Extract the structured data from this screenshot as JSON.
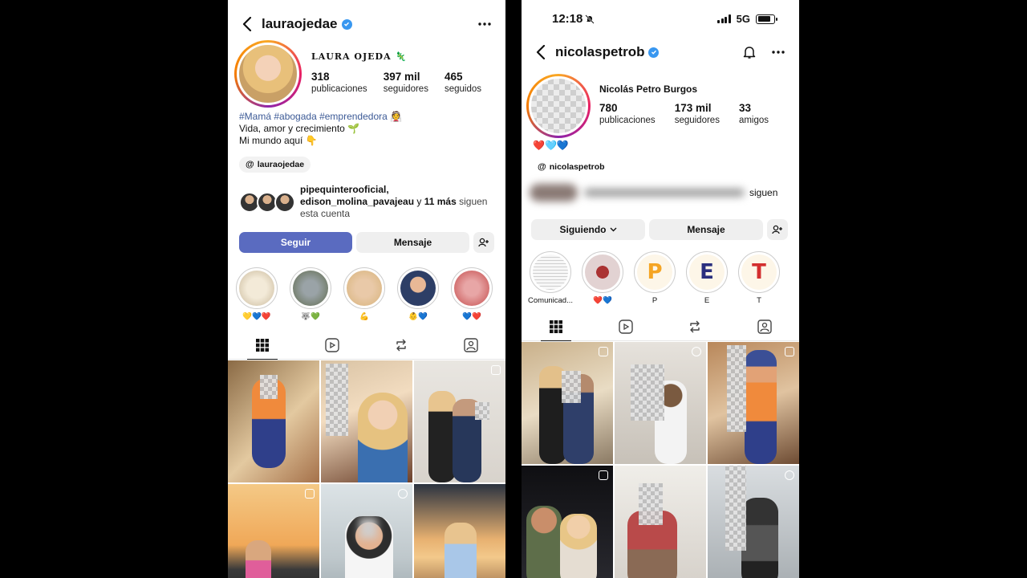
{
  "left": {
    "handle": "lauraojedae",
    "display_name": "LAURA OJEDA",
    "stats": [
      {
        "num": "318",
        "label": "publicaciones"
      },
      {
        "num": "397 mil",
        "label": "seguidores"
      },
      {
        "num": "465",
        "label": "seguidos"
      }
    ],
    "bio": {
      "tags": "#Mamá #abogada #emprendedora",
      "line2": "Vida, amor y crecimiento",
      "line3": "Mi mundo aquí"
    },
    "threads": "lauraojedae",
    "followed_by": {
      "name1": "pipequinterooficial,",
      "name2": "edison_molina_pavajeau",
      "and": " y ",
      "more": "11 más",
      "suffix": " siguen",
      "line3": "esta cuenta"
    },
    "buttons": {
      "follow": "Seguir",
      "message": "Mensaje"
    },
    "highlights": [
      {
        "label": "💛💙❤️"
      },
      {
        "label": "🐺💚"
      },
      {
        "label": "💪"
      },
      {
        "label": "👶💙"
      },
      {
        "label": "💙❤️"
      }
    ]
  },
  "right": {
    "status_time": "12:18",
    "network": "5G",
    "handle": "nicolaspetrob",
    "display_name": "Nicolás Petro Burgos",
    "stats": [
      {
        "num": "780",
        "label": "publicaciones"
      },
      {
        "num": "173 mil",
        "label": "seguidores"
      },
      {
        "num": "33",
        "label": "amigos"
      }
    ],
    "hearts": "❤️🩵💙",
    "threads": "nicolaspetrob",
    "followed_by_suffix": "siguen",
    "buttons": {
      "following": "Siguiendo",
      "message": "Mensaje"
    },
    "highlights": [
      {
        "label": "Comunicad...",
        "letter": "",
        "color": "#f4f4f4"
      },
      {
        "label": "❤️💙",
        "letter": "",
        "color": "#e8d8d8"
      },
      {
        "label": "P",
        "letter": "P",
        "color": "#f5a524"
      },
      {
        "label": "E",
        "letter": "E",
        "color": "#2a2f7e"
      },
      {
        "label": "T",
        "letter": "T",
        "color": "#d32f2f"
      }
    ]
  }
}
